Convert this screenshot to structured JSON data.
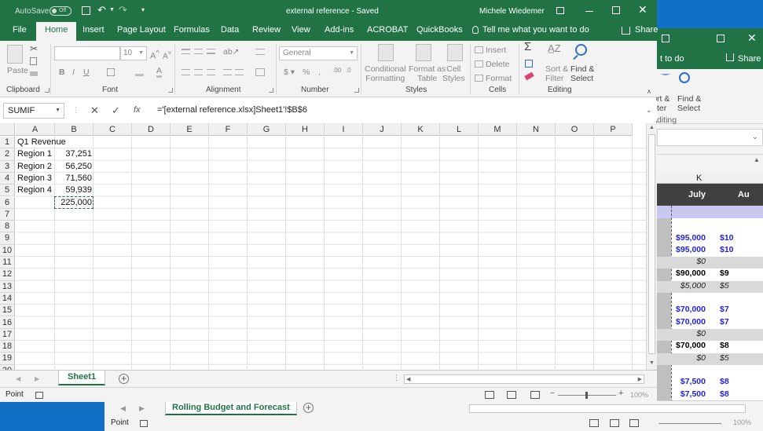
{
  "background_window": {
    "ribbon": {
      "find_select": "Find &\nSelect",
      "sort_filter": "rt &\nter",
      "group_editing": "diting"
    },
    "tab_share": "Share",
    "tab_partial": "t to do",
    "col_header": "K",
    "month_1": "July",
    "month_2": "Au",
    "rows": [
      {
        "v1": "$95,000",
        "v2": "$10",
        "style": "blue"
      },
      {
        "v1": "$95,000",
        "v2": "$10",
        "style": "blue"
      },
      {
        "v1": "$0",
        "v2": "",
        "style": "italic-grey"
      },
      {
        "v1": "$90,000",
        "v2": "$9",
        "style": "black"
      },
      {
        "v1": "$5,000",
        "v2": "$5",
        "style": "italic-grey"
      },
      {
        "v1": "$70,000",
        "v2": "$7",
        "style": "blue"
      },
      {
        "v1": "$70,000",
        "v2": "$7",
        "style": "blue"
      },
      {
        "v1": "$0",
        "v2": "",
        "style": "italic-grey"
      },
      {
        "v1": "$70,000",
        "v2": "$8",
        "style": "black"
      },
      {
        "v1": "$0",
        "v2": "$5",
        "style": "italic-grey"
      },
      {
        "v1": "$7,500",
        "v2": "$8",
        "style": "blue"
      },
      {
        "v1": "$7,500",
        "v2": "$8",
        "style": "blue"
      }
    ],
    "sheet_tab": "Rolling Budget and Forecast",
    "status": "Point",
    "zoom": "100%"
  },
  "titlebar": {
    "autosave_label": "AutoSave",
    "autosave_state": "Off",
    "doc_title": "external reference  -  Saved",
    "user_name": "Michele Wiedemer"
  },
  "tabs": [
    {
      "label": "File"
    },
    {
      "label": "Home"
    },
    {
      "label": "Insert"
    },
    {
      "label": "Page Layout"
    },
    {
      "label": "Formulas"
    },
    {
      "label": "Data"
    },
    {
      "label": "Review"
    },
    {
      "label": "View"
    },
    {
      "label": "Add-ins"
    },
    {
      "label": "ACROBAT"
    },
    {
      "label": "QuickBooks"
    }
  ],
  "tell_me": "Tell me what you want to do",
  "share": "Share",
  "ribbon": {
    "paste": "Paste",
    "font_size": "10",
    "number_format": "General",
    "conditional_formatting": "Conditional\nFormatting",
    "format_as_table": "Format as\nTable",
    "cell_styles": "Cell\nStyles",
    "insert": "Insert",
    "delete": "Delete",
    "format": "Format",
    "sort_filter": "Sort &\nFilter",
    "find_select": "Find &\nSelect",
    "groups": {
      "clipboard": "Clipboard",
      "font": "Font",
      "alignment": "Alignment",
      "number": "Number",
      "styles": "Styles",
      "cells": "Cells",
      "editing": "Editing"
    }
  },
  "formula_bar": {
    "name_box": "SUMIF",
    "fx": "fx",
    "formula": "='[external reference.xlsx]Sheet1'!$B$6"
  },
  "columns": [
    "A",
    "B",
    "C",
    "D",
    "E",
    "F",
    "G",
    "H",
    "I",
    "J",
    "K",
    "L",
    "M",
    "N",
    "O",
    "P"
  ],
  "rows": [
    "1",
    "2",
    "3",
    "4",
    "5",
    "6",
    "7",
    "8",
    "9",
    "10",
    "11",
    "12",
    "13",
    "14",
    "15",
    "16",
    "17",
    "18",
    "19",
    "20"
  ],
  "cells": {
    "A1": "Q1 Revenue",
    "A2": "Region 1",
    "B2": "37,251",
    "A3": "Region 2",
    "B3": "56,250",
    "A4": "Region 3",
    "B4": "71,560",
    "A5": "Region 4",
    "B5": "59,939",
    "B6": "225,000"
  },
  "sheet_tab": "Sheet1",
  "status": "Point",
  "zoom": "100%",
  "colors": {
    "excel_green": "#217346",
    "desktop_blue": "#1170c6",
    "value_blue": "#1f1fd6"
  }
}
